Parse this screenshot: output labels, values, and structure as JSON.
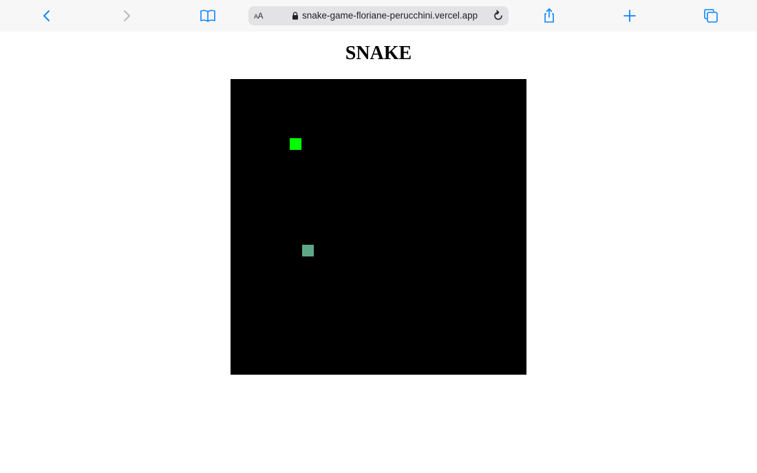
{
  "browser": {
    "address_bar": {
      "text_size_label_small": "A",
      "text_size_label_large": "A",
      "url": "snake-game-floriane-perucchini.vercel.app"
    },
    "icons": {
      "back": "chevron-left-icon",
      "forward": "chevron-right-icon",
      "reader": "book-icon",
      "lock": "lock-icon",
      "reload": "reload-icon",
      "share": "share-icon",
      "new_tab": "plus-icon",
      "tabs": "tabs-icon"
    },
    "colors": {
      "accent": "#0a84ff",
      "disabled": "#b8b8b8",
      "toolbar_bg": "#f7f7f7"
    }
  },
  "page": {
    "title": "SNAKE"
  },
  "game": {
    "board_color": "#000000",
    "snake_color": "#00ff00",
    "food_color": "#5fa887"
  }
}
